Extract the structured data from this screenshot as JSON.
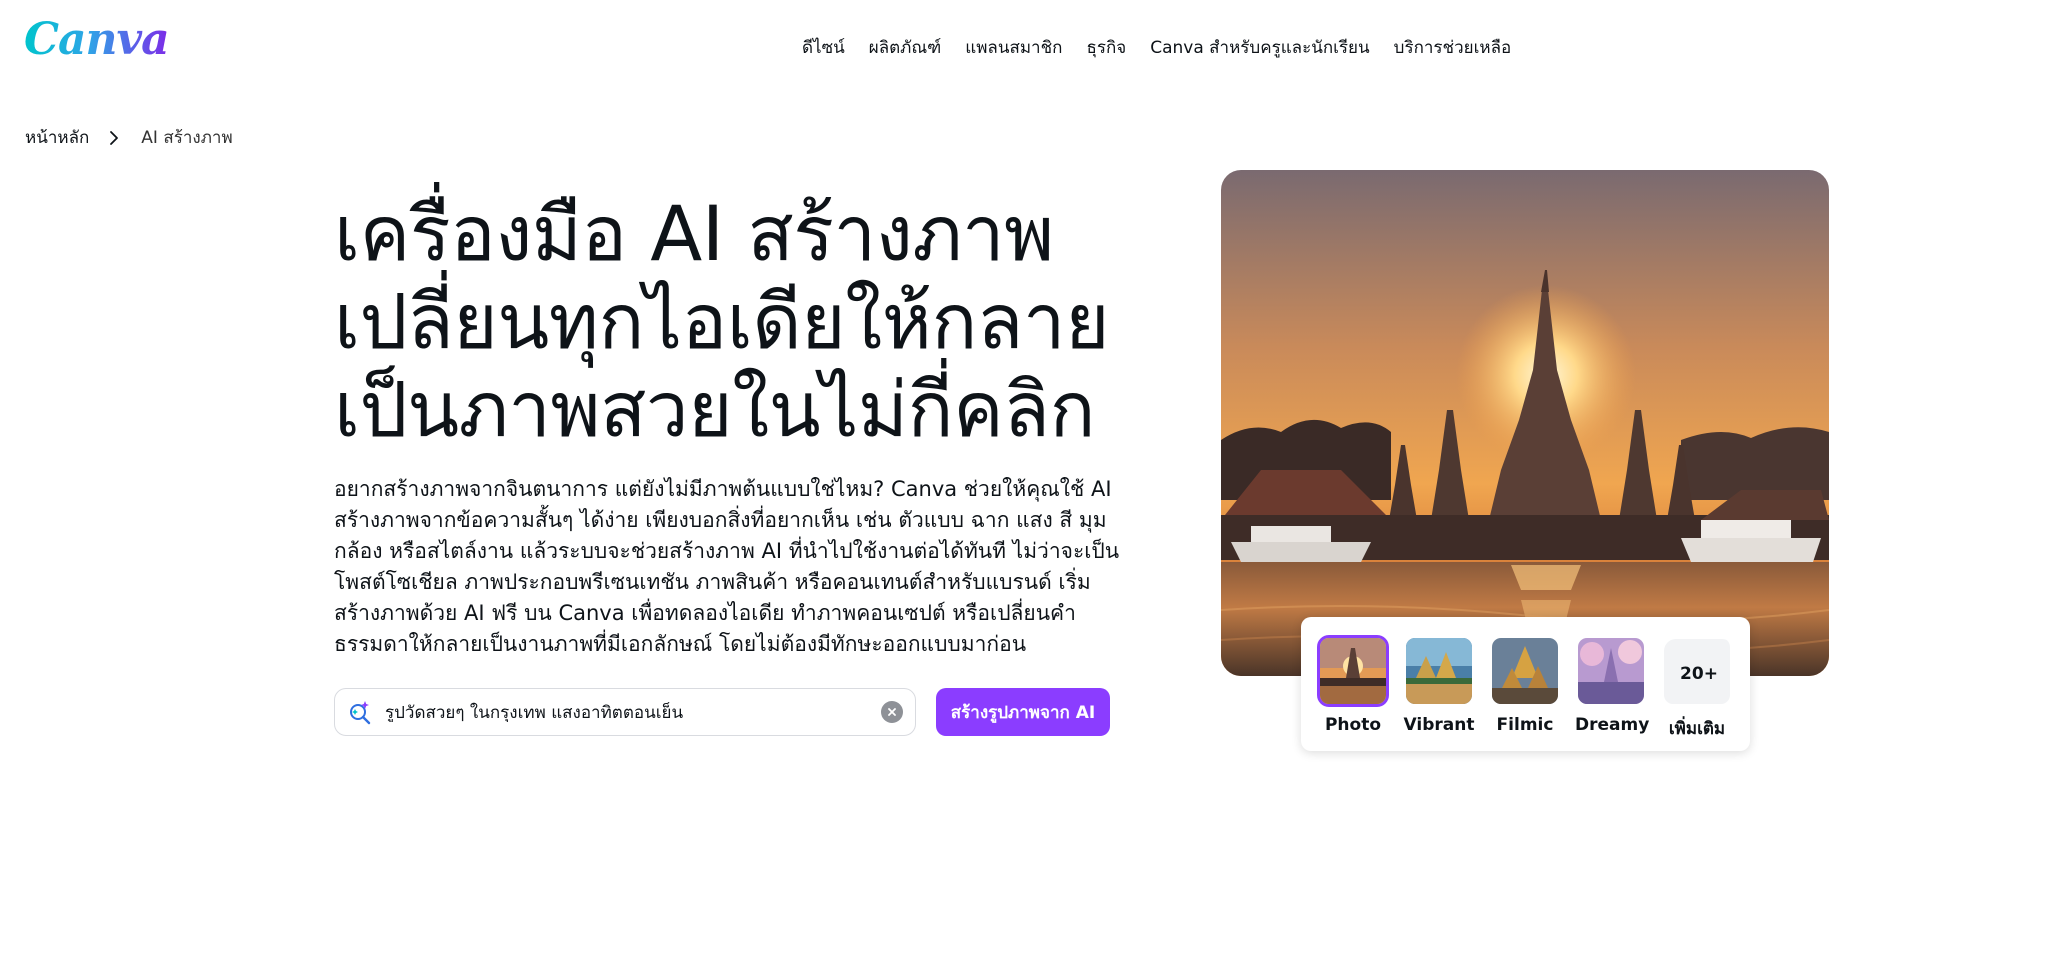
{
  "brand": {
    "logo_text": "Canva"
  },
  "nav": {
    "items": [
      {
        "label": "ดีไซน์"
      },
      {
        "label": "ผลิตภัณฑ์"
      },
      {
        "label": "แพลนสมาชิก"
      },
      {
        "label": "ธุรกิจ"
      },
      {
        "label": "Canva สำหรับครูและนักเรียน"
      },
      {
        "label": "บริการช่วยเหลือ"
      }
    ]
  },
  "breadcrumb": {
    "home": "หน้าหลัก",
    "current": "AI สร้างภาพ"
  },
  "hero": {
    "title_lines": [
      "เครื่องมือ AI สร้างภาพ",
      "เปลี่ยนทุกไอเดียให้กลาย",
      "เป็นภาพสวยในไม่กี่คลิก"
    ],
    "description": "อยากสร้างภาพจากจินตนาการ แต่ยังไม่มีภาพต้นแบบใช่ไหม? Canva ช่วยให้คุณใช้ AI สร้างภาพจากข้อความสั้นๆ ได้ง่าย เพียงบอกสิ่งที่อยากเห็น เช่น ตัวแบบ ฉาก แสง สี มุมกล้อง หรือสไตล์งาน แล้วระบบจะช่วยสร้างภาพ AI ที่นำไปใช้งานต่อได้ทันที ไม่ว่าจะเป็นโพสต์โซเชียล ภาพประกอบพรีเซนเทชัน ภาพสินค้า หรือคอนเทนต์สำหรับแบรนด์ เริ่มสร้างภาพด้วย AI ฟรี บน Canva เพื่อทดลองไอเดีย ทำภาพคอนเซปต์ หรือเปลี่ยนคำธรรมดาให้กลายเป็นงานภาพที่มีเอกลักษณ์ โดยไม่ต้องมีทักษะออกแบบมาก่อน"
  },
  "search": {
    "value": "รูปวัดสวยๆ ในกรุงเทพ แสงอาทิตตอนเย็น",
    "icon": "sparkle-search-icon",
    "clear_icon": "clear-icon"
  },
  "generate_button": {
    "label": "สร้างรูปภาพจาก AI"
  },
  "styles": {
    "options": [
      {
        "label": "Photo",
        "selected": true
      },
      {
        "label": "Vibrant",
        "selected": false
      },
      {
        "label": "Filmic",
        "selected": false
      },
      {
        "label": "Dreamy",
        "selected": false
      }
    ],
    "more": {
      "count_label": "20+",
      "label": "เพิ่มเติม"
    }
  },
  "colors": {
    "accent": "#8b3dff",
    "text": "#0e1318"
  }
}
